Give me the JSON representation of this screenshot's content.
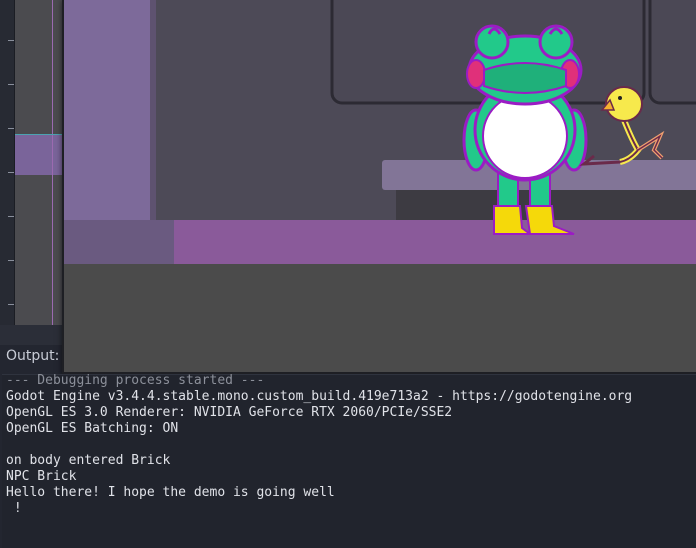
{
  "output_panel": {
    "label": "Output:",
    "lines": [
      "--- Debugging process started ---",
      "Godot Engine v3.4.4.stable.mono.custom_build.419e713a2 - https://godotengine.org",
      "OpenGL ES 3.0 Renderer: NVIDIA GeForce RTX 2060/PCIe/SSE2",
      "OpenGL ES Batching: ON",
      "",
      "on body entered Brick",
      "NPC Brick",
      "Hello there! I hope the demo is going well",
      " !"
    ]
  },
  "game_scene": {
    "characters": [
      "frog-character",
      "yellow-bird-npc"
    ]
  },
  "colors": {
    "editor_bg": "#3b3f4c",
    "output_bg": "#21242d",
    "game_wall": "#4b4b4b",
    "game_floor": "#8a5a9a",
    "frog_green": "#22c98a",
    "frog_outline": "#9b1cc4",
    "boot_yellow": "#f5d90a",
    "bird_yellow": "#f7e94c"
  }
}
